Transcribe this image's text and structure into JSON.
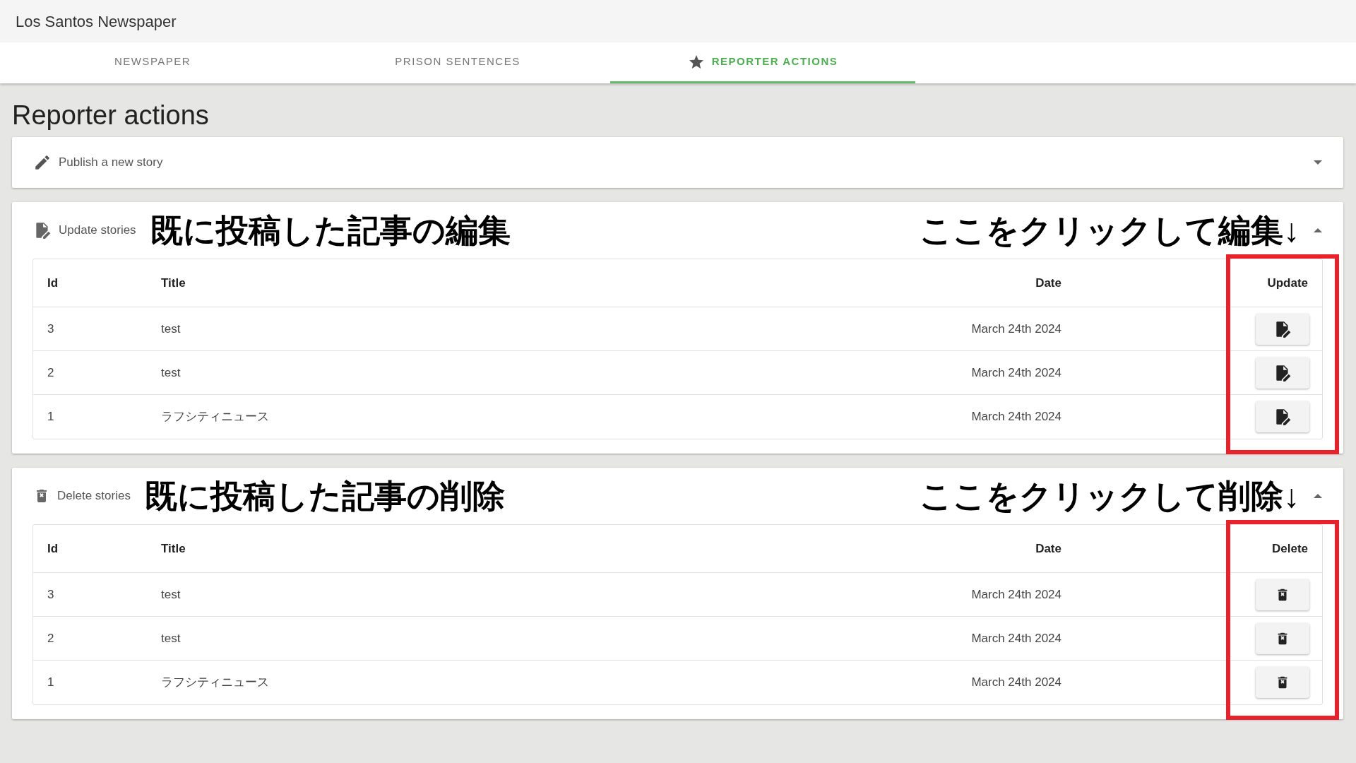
{
  "app_title": "Los Santos Newspaper",
  "tabs": [
    {
      "label": "NEWSPAPER",
      "selected": false
    },
    {
      "label": "PRISON SENTENCES",
      "selected": false
    },
    {
      "label": "REPORTER ACTIONS",
      "selected": true
    }
  ],
  "page_title": "Reporter actions",
  "sections": [
    {
      "kind": "publish",
      "title": "Publish a new story",
      "expanded": false
    },
    {
      "kind": "update",
      "title": "Update stories",
      "expanded": true,
      "annotation": "既に投稿した記事の編集",
      "hint": "ここをクリックして編集↓",
      "table": {
        "columns": [
          "Id",
          "Title",
          "Date",
          "Update"
        ],
        "rows": [
          {
            "id": "3",
            "title": "test",
            "date": "March 24th 2024"
          },
          {
            "id": "2",
            "title": "test",
            "date": "March 24th 2024"
          },
          {
            "id": "1",
            "title": "ラフシティニュース",
            "date": "March 24th 2024"
          }
        ]
      }
    },
    {
      "kind": "delete",
      "title": "Delete stories",
      "expanded": true,
      "annotation": "既に投稿した記事の削除",
      "hint": "ここをクリックして削除↓",
      "table": {
        "columns": [
          "Id",
          "Title",
          "Date",
          "Delete"
        ],
        "rows": [
          {
            "id": "3",
            "title": "test",
            "date": "March 24th 2024"
          },
          {
            "id": "2",
            "title": "test",
            "date": "March 24th 2024"
          },
          {
            "id": "1",
            "title": "ラフシティニュース",
            "date": "March 24th 2024"
          }
        ]
      }
    }
  ]
}
